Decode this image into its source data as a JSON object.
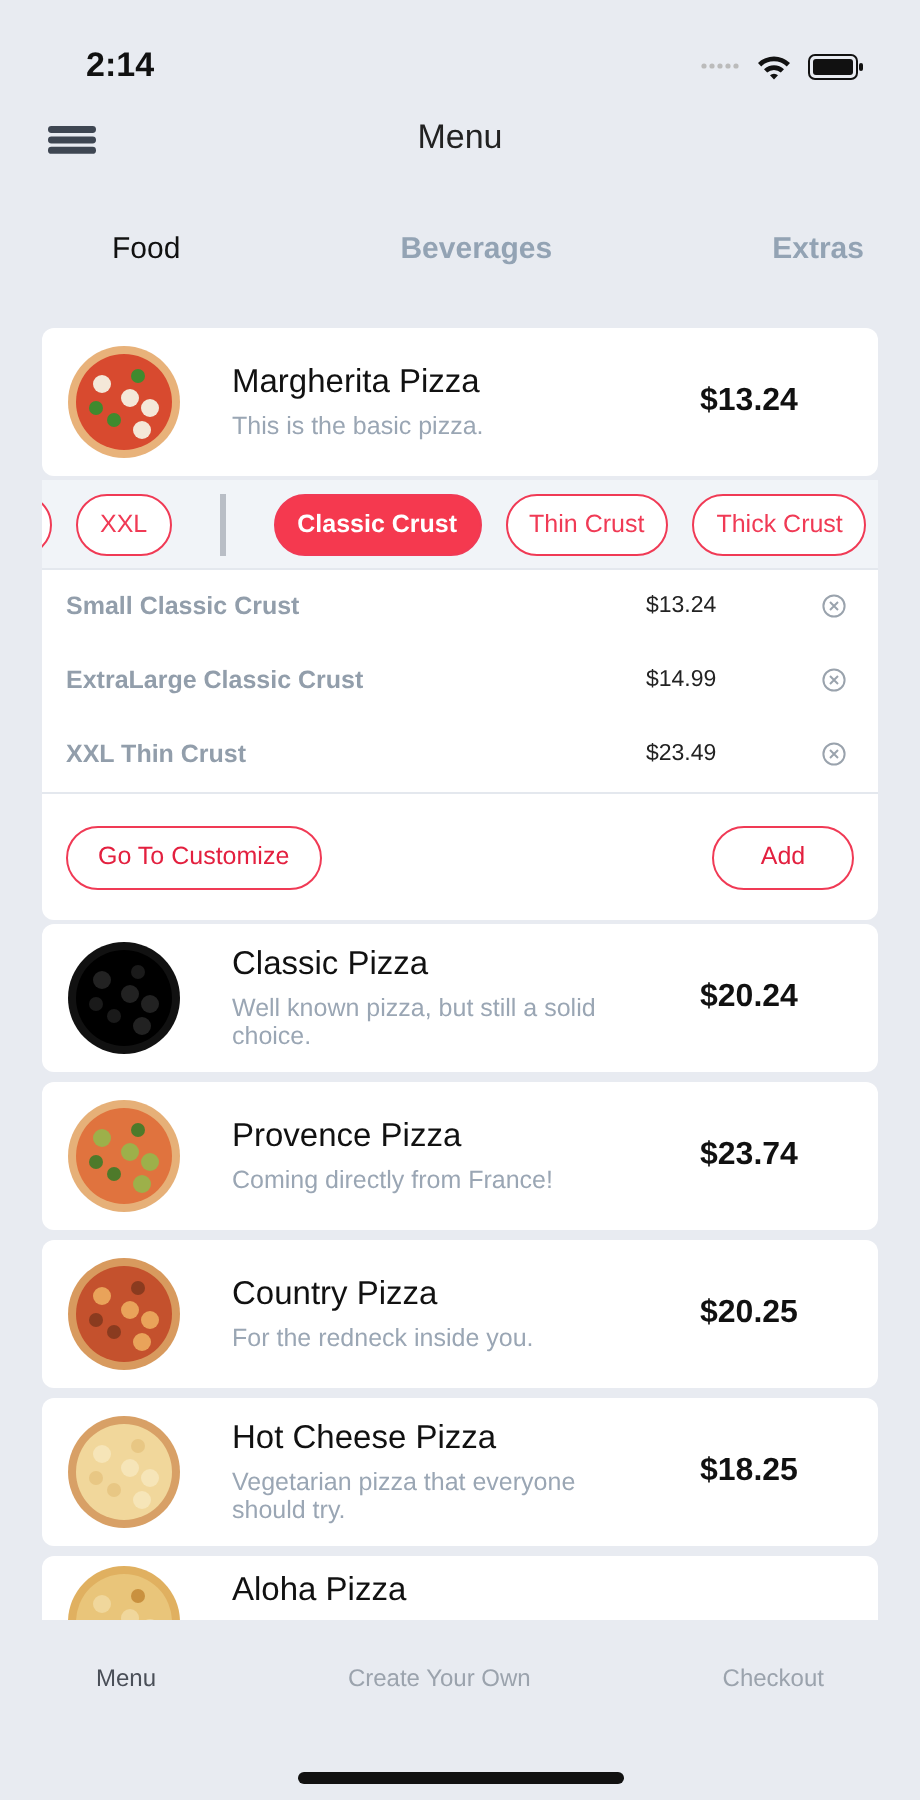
{
  "status_bar": {
    "time": "2:14"
  },
  "header": {
    "title": "Menu"
  },
  "tabs": [
    {
      "label": "Food",
      "selected": true
    },
    {
      "label": "Beverages",
      "selected": false
    },
    {
      "label": "Extras",
      "selected": false
    }
  ],
  "expanded_item": {
    "name": "Margherita Pizza",
    "description": "This is the basic pizza.",
    "price": "$13.24",
    "image": {
      "kind": "picture"
    },
    "size_options": [
      {
        "selected": false
      },
      {
        "label": "XXL",
        "selected": false
      }
    ],
    "crust_options": [
      {
        "label": "Classic Crust",
        "selected": true
      },
      {
        "label": "Thin Crust",
        "selected": false
      },
      {
        "label": "Thick Crust",
        "selected": false
      }
    ],
    "selections": [
      {
        "name": "Small Classic Crust",
        "price": "$13.24"
      },
      {
        "name": "ExtraLarge Classic Crust",
        "price": "$14.99"
      },
      {
        "name": "XXL Thin Crust",
        "price": "$23.49"
      }
    ],
    "actions": [
      "Go To Customize",
      "Add"
    ]
  },
  "items": [
    {
      "name": "Classic Pizza",
      "description": "Well known pizza, but still a solid choice.",
      "price": "$20.24",
      "image": {
        "kind": "picture"
      }
    },
    {
      "name": "Provence Pizza",
      "description": "Coming directly from France!",
      "price": "$23.74",
      "image": {
        "kind": "picture"
      }
    },
    {
      "name": "Country Pizza",
      "description": "For the redneck inside you.",
      "price": "$20.25",
      "image": {
        "kind": "picture"
      }
    },
    {
      "name": "Hot Cheese Pizza",
      "description": "Vegetarian pizza that everyone should try.",
      "price": "$18.25",
      "image": {
        "kind": "picture"
      }
    },
    {
      "name": "Aloha Pizza",
      "image": {
        "kind": "picture"
      }
    }
  ],
  "bottom_nav": [
    {
      "label": "Menu",
      "selected": true
    },
    {
      "label": "Create Your Own",
      "selected": false
    },
    {
      "label": "Checkout",
      "selected": false
    }
  ]
}
